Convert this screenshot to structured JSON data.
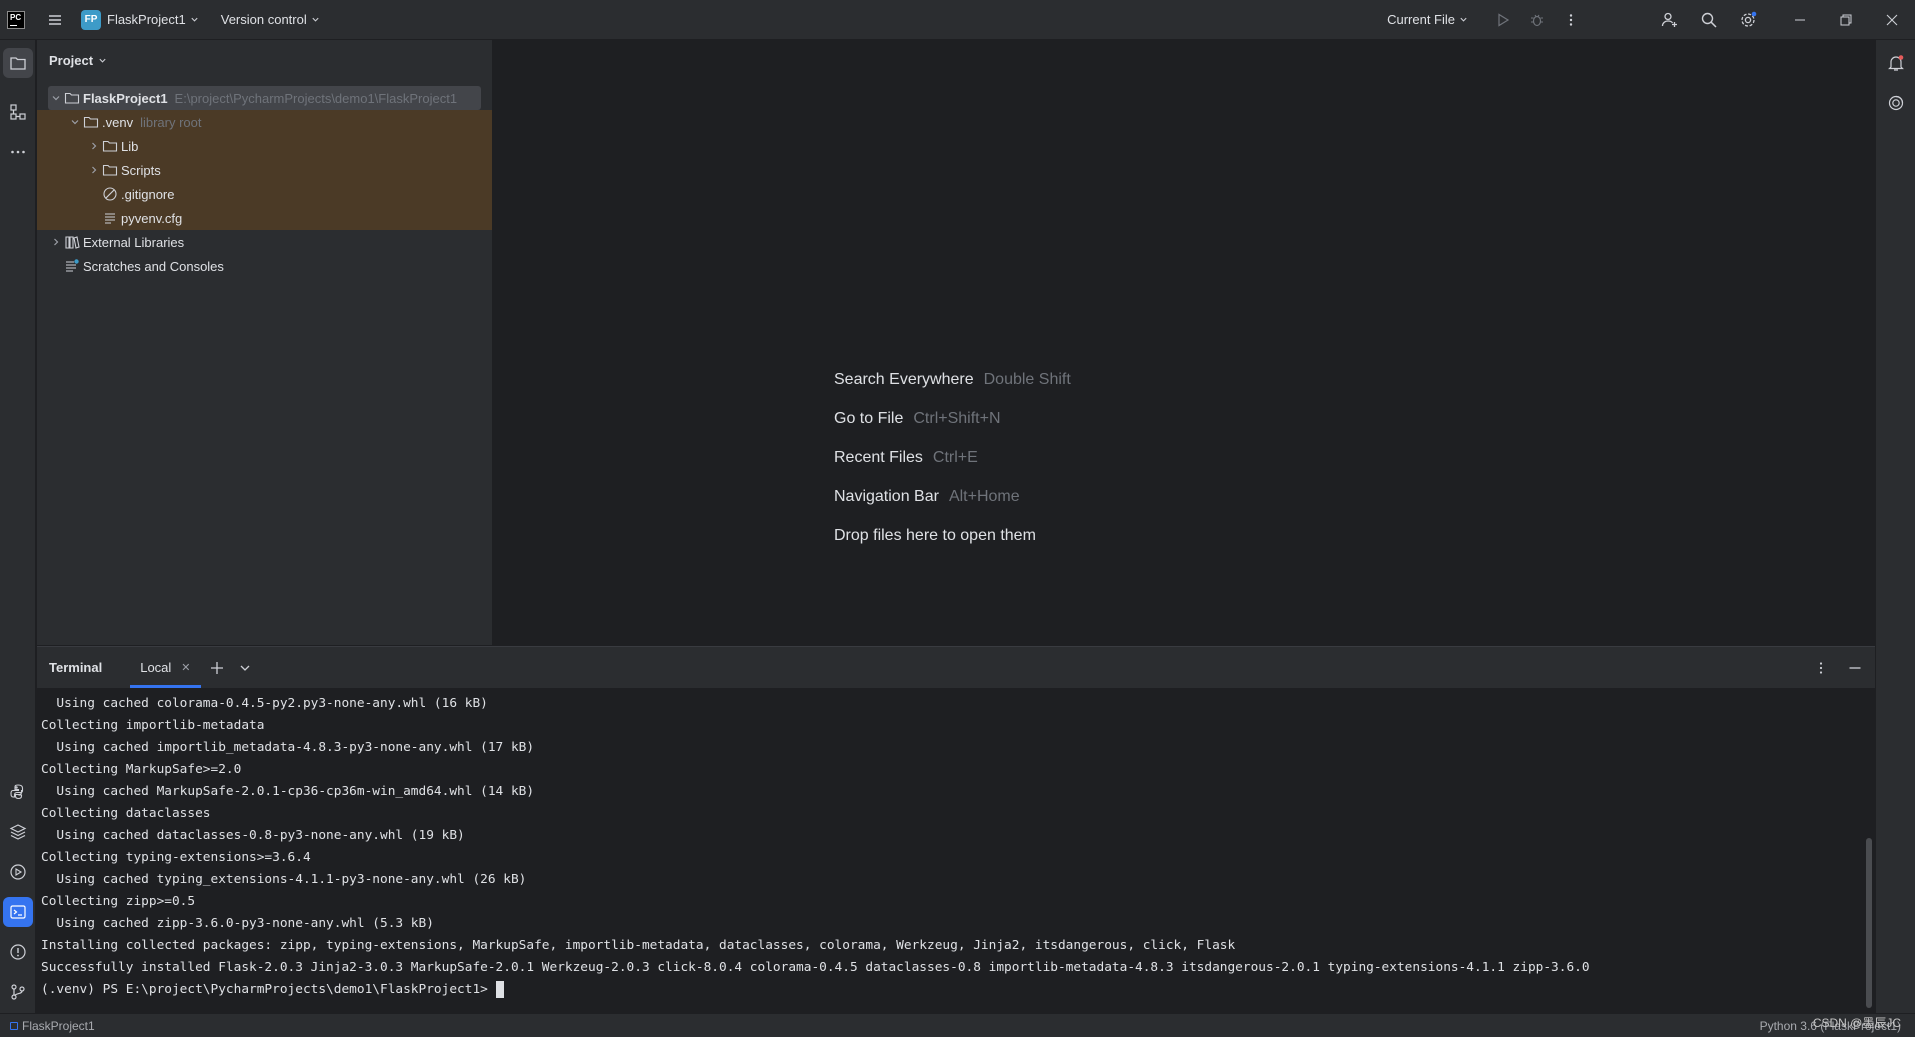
{
  "titlebar": {
    "project_initials": "FP",
    "project_name": "FlaskProject1",
    "vcs_label": "Version control",
    "run_config": "Current File"
  },
  "project_panel": {
    "title": "Project",
    "tree": [
      {
        "label": "FlaskProject1",
        "hint": "E:\\project\\PycharmProjects\\demo1\\FlaskProject1"
      },
      {
        "label": ".venv",
        "hint": "library root"
      },
      {
        "label": "Lib"
      },
      {
        "label": "Scripts"
      },
      {
        "label": ".gitignore"
      },
      {
        "label": "pyvenv.cfg"
      },
      {
        "label": "External Libraries"
      },
      {
        "label": "Scratches and Consoles"
      }
    ]
  },
  "editor": {
    "hints": [
      {
        "action": "Search Everywhere",
        "shortcut": "Double Shift"
      },
      {
        "action": "Go to File",
        "shortcut": "Ctrl+Shift+N"
      },
      {
        "action": "Recent Files",
        "shortcut": "Ctrl+E"
      },
      {
        "action": "Navigation Bar",
        "shortcut": "Alt+Home"
      },
      {
        "action": "Drop files here to open them",
        "shortcut": ""
      }
    ]
  },
  "terminal": {
    "title": "Terminal",
    "tab_label": "Local",
    "lines": [
      "  Using cached colorama-0.4.5-py2.py3-none-any.whl (16 kB)",
      "Collecting importlib-metadata",
      "  Using cached importlib_metadata-4.8.3-py3-none-any.whl (17 kB)",
      "Collecting MarkupSafe>=2.0",
      "  Using cached MarkupSafe-2.0.1-cp36-cp36m-win_amd64.whl (14 kB)",
      "Collecting dataclasses",
      "  Using cached dataclasses-0.8-py3-none-any.whl (19 kB)",
      "Collecting typing-extensions>=3.6.4",
      "  Using cached typing_extensions-4.1.1-py3-none-any.whl (26 kB)",
      "Collecting zipp>=0.5",
      "  Using cached zipp-3.6.0-py3-none-any.whl (5.3 kB)",
      "Installing collected packages: zipp, typing-extensions, MarkupSafe, importlib-metadata, dataclasses, colorama, Werkzeug, Jinja2, itsdangerous, click, Flask",
      "Successfully installed Flask-2.0.3 Jinja2-3.0.3 MarkupSafe-2.0.1 Werkzeug-2.0.3 click-8.0.4 colorama-0.4.5 dataclasses-0.8 importlib-metadata-4.8.3 itsdangerous-2.0.1 typing-extensions-4.1.1 zipp-3.6.0"
    ],
    "prompt": "(.venv) PS E:\\project\\PycharmProjects\\demo1\\FlaskProject1> "
  },
  "statusbar": {
    "project": "FlaskProject1",
    "interpreter": "Python 3.6 (FlaskProject1)",
    "watermark": "CSDN @墨辰JC"
  },
  "colors": {
    "accent": "#3574f0",
    "project_badge": "#3d9bc8",
    "venv_highlight": "#4b3a26",
    "background": "#1e1f22",
    "panel": "#2b2d30"
  }
}
